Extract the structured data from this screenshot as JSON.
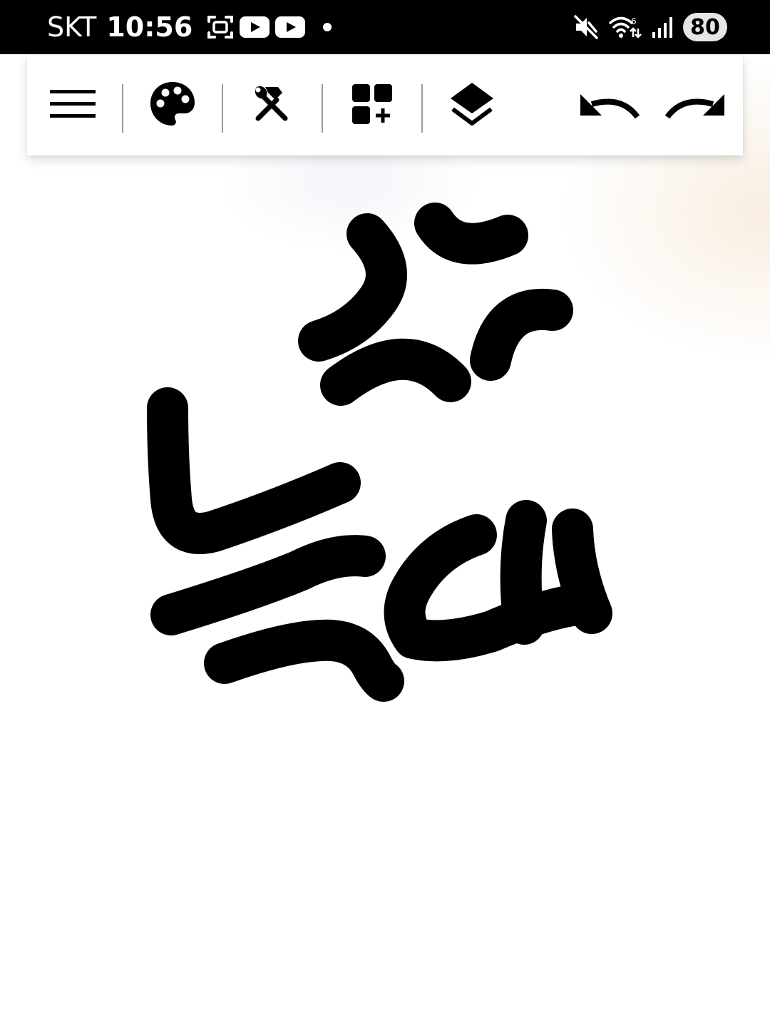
{
  "status_bar": {
    "carrier": "SKT",
    "time": "10:56",
    "notification_icons": [
      "screenshot-icon",
      "youtube-icon",
      "youtube-icon",
      "dot-icon"
    ],
    "system_icons": [
      "mute-icon",
      "wifi-icon",
      "signal-icon"
    ],
    "battery": "80"
  },
  "toolbar": {
    "buttons": [
      {
        "name": "menu-button",
        "icon": "hamburger-menu-icon"
      },
      {
        "name": "palette-button",
        "icon": "palette-icon"
      },
      {
        "name": "tools-button",
        "icon": "tools-icon"
      },
      {
        "name": "add-widget-button",
        "icon": "add-widget-icon"
      },
      {
        "name": "layers-button",
        "icon": "layers-icon"
      },
      {
        "name": "undo-button",
        "icon": "undo-icon"
      },
      {
        "name": "redo-button",
        "icon": "redo-icon"
      }
    ]
  },
  "canvas": {
    "stroke_color": "#000000",
    "background_color": "#ffffff"
  },
  "colors": {
    "status_bar_bg": "#000000",
    "toolbar_bg": "#ffffff",
    "icon_color": "#000000"
  }
}
